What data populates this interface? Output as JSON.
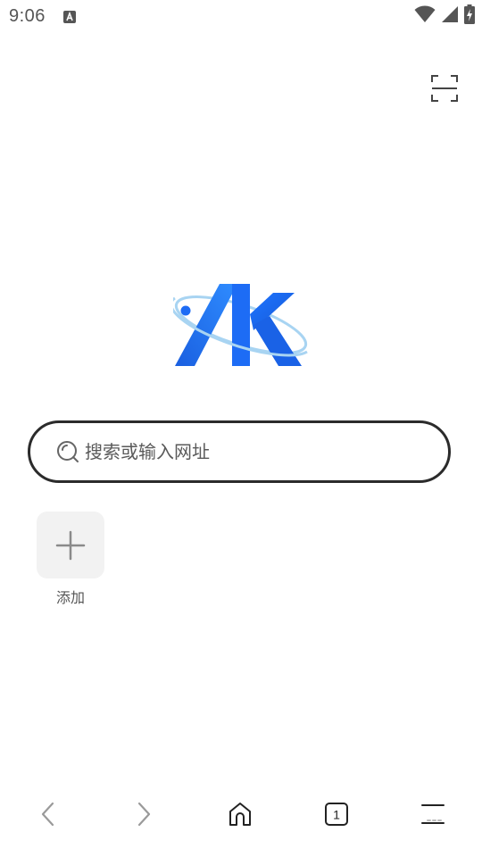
{
  "status_bar": {
    "time": "9:06",
    "icons": [
      "app-notification-icon",
      "wifi-icon",
      "cell-signal-icon",
      "battery-charging-icon"
    ]
  },
  "toolbar": {
    "scan_icon": "scan-frame-icon"
  },
  "logo": {
    "icon": "ak-orbit-logo",
    "brand_colors": [
      "#1a66e8",
      "#2e8bff",
      "#9fd0f4"
    ]
  },
  "search": {
    "placeholder": "搜索或输入网址",
    "value": "",
    "icon": "search-icon"
  },
  "shortcuts": {
    "add_label": "添加",
    "add_icon": "plus-icon"
  },
  "bottom_nav": {
    "back_icon": "chevron-left-icon",
    "forward_icon": "chevron-right-icon",
    "home_icon": "home-icon",
    "tab_count": "1",
    "menu_icon": "menu-icon"
  },
  "colors": {
    "search_border": "#2b2b2b",
    "tile_background": "#f2f2f2",
    "nav_icon": "#222222",
    "nav_icon_disabled": "#9a9a9a"
  }
}
